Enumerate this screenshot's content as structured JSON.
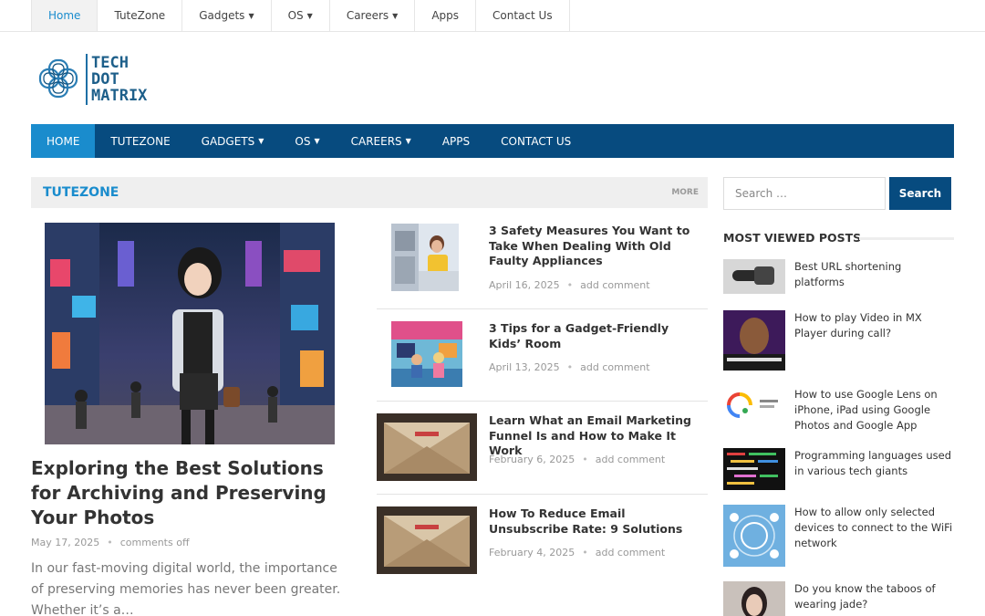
{
  "topnav": {
    "items": [
      {
        "label": "Home",
        "dropdown": false
      },
      {
        "label": "TuteZone",
        "dropdown": false
      },
      {
        "label": "Gadgets",
        "dropdown": true
      },
      {
        "label": "OS",
        "dropdown": true
      },
      {
        "label": "Careers",
        "dropdown": true
      },
      {
        "label": "Apps",
        "dropdown": false
      },
      {
        "label": "Contact Us",
        "dropdown": false
      }
    ]
  },
  "logo": {
    "line1": "TECH",
    "line2": "DOT",
    "line3": "MATRIX"
  },
  "mainnav": {
    "items": [
      {
        "label": "HOME",
        "dropdown": false
      },
      {
        "label": "TUTEZONE",
        "dropdown": false
      },
      {
        "label": "GADGETS",
        "dropdown": true
      },
      {
        "label": "OS",
        "dropdown": true
      },
      {
        "label": "CAREERS",
        "dropdown": true
      },
      {
        "label": "APPS",
        "dropdown": false
      },
      {
        "label": "CONTACT US",
        "dropdown": false
      }
    ]
  },
  "section": {
    "title": "TUTEZONE",
    "more": "MORE"
  },
  "featured": {
    "title": "Exploring the Best Solutions for Archiving and Preserving Your Photos",
    "date": "May 17, 2025",
    "comments": "comments off",
    "excerpt": "In our fast-moving digital world, the importance of preserving memories has never been greater. Whether it’s a…"
  },
  "list": [
    {
      "title": "3 Safety Measures You Want to Take When Dealing With Old Faulty Appliances",
      "date": "April 16, 2025",
      "comments": "add comment"
    },
    {
      "title": "3 Tips for a Gadget-Friendly Kids’ Room",
      "date": "April 13, 2025",
      "comments": "add comment"
    },
    {
      "title": "Learn What an Email Marketing Funnel Is and How to Make It Work",
      "date": "February 6, 2025",
      "comments": "add comment"
    },
    {
      "title": "How To Reduce Email Unsubscribe Rate: 9 Solutions",
      "date": "February 4, 2025",
      "comments": "add comment"
    }
  ],
  "sidebar": {
    "search_placeholder": "Search …",
    "search_button": "Search",
    "most_viewed_title": "MOST VIEWED POSTS",
    "posts": [
      "Best URL shortening platforms",
      "How to play Video in MX Player during call?",
      "How to use Google Lens on iPhone, iPad using Google Photos and Google App",
      "Programming languages used in various tech giants",
      "How to allow only selected devices to connect to the WiFi network",
      "Do you know the taboos of wearing jade?"
    ]
  },
  "colors": {
    "accent": "#1a8ccd",
    "nav": "#074b7f",
    "meta": "#999999"
  },
  "icons": {
    "caret": "chevron-down-icon",
    "dot": "separator-dot"
  }
}
